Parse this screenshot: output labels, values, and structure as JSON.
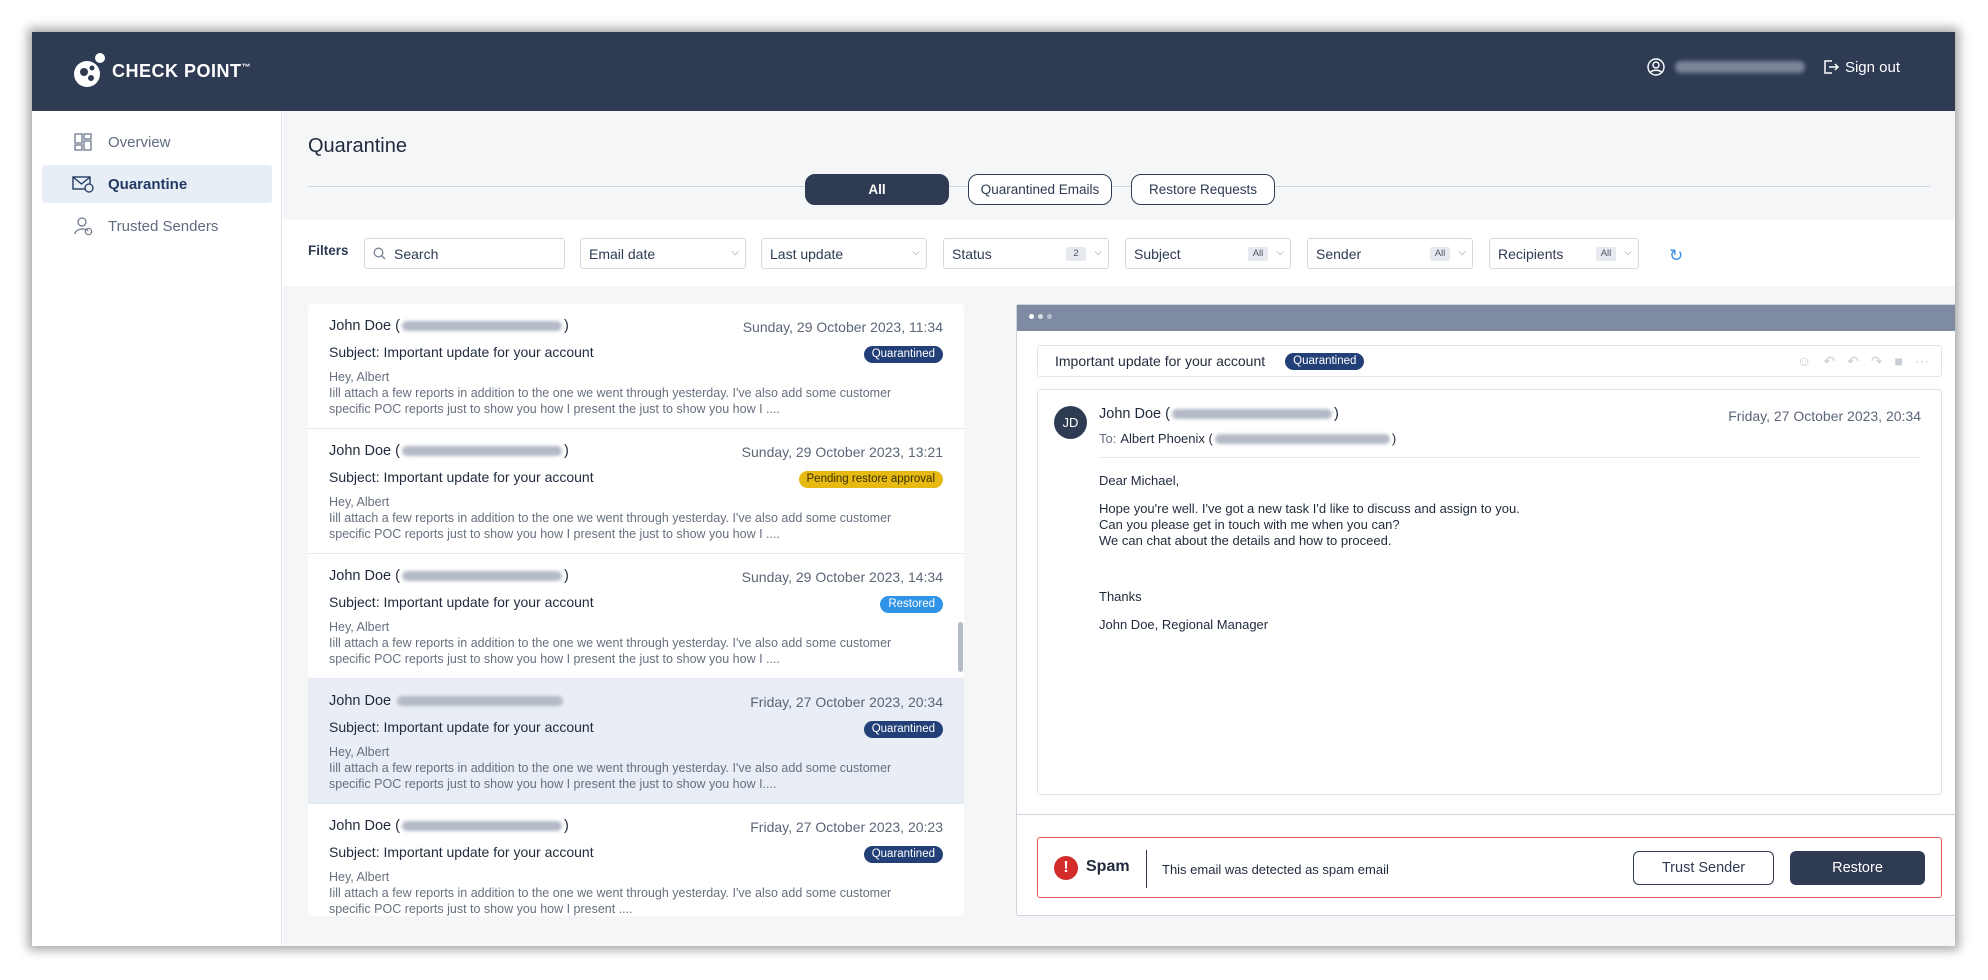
{
  "header": {
    "brand": "CHECK POINT",
    "brand_tm": "™",
    "sign_out": "Sign out"
  },
  "sidebar": {
    "items": [
      {
        "label": "Overview",
        "icon": "dashboard-icon"
      },
      {
        "label": "Quarantine",
        "icon": "mail-shield-icon",
        "active": true
      },
      {
        "label": "Trusted Senders",
        "icon": "user-check-icon"
      }
    ]
  },
  "page": {
    "title": "Quarantine",
    "tabs": [
      {
        "label": "All",
        "active": true
      },
      {
        "label": "Quarantined Emails"
      },
      {
        "label": "Restore Requests"
      }
    ]
  },
  "filters": {
    "label": "Filters",
    "search_placeholder": "Search",
    "email_date": "Email date",
    "last_update": "Last update",
    "status": "Status",
    "status_count": "2",
    "subject": "Subject",
    "subject_count": "All",
    "sender": "Sender",
    "sender_count": "All",
    "recipients": "Recipients",
    "recipients_count": "All"
  },
  "emails": [
    {
      "from": "John Doe (",
      "from_close": ")",
      "date": "Sunday, 29 October 2023, 11:34",
      "subject": "Subject: Important update for your account",
      "status": "Quarantined",
      "greeting": "Hey,  Albert",
      "body": "Iill attach a few reports in addition to the one we went through yesterday. I've also add some customer specific POC reports just to show you how I present the just to show you how I ...."
    },
    {
      "from": "John Doe (",
      "from_close": ")",
      "date": "Sunday, 29 October 2023, 13:21",
      "subject": "Subject: Important update for your account",
      "status": "Pending restore approval",
      "greeting": "Hey,  Albert",
      "body": "Iill attach a few reports in addition to the one we went through yesterday. I've also add some customer specific POC reports just to show you how I present the just to show you how I ...."
    },
    {
      "from": "John Doe (",
      "from_close": ")",
      "date": "Sunday, 29 October 2023, 14:34",
      "subject": "Subject: Important update for your account",
      "status": "Restored",
      "greeting": "Hey,  Albert",
      "body": "Iill attach a few reports in addition to the one we went through yesterday. I've also add some customer specific POC reports just to show you how I present the just to show you how I ...."
    },
    {
      "from": "John Doe",
      "from_close": "",
      "date": "Friday, 27 October 2023, 20:34",
      "subject": "Subject: Important update for your account",
      "status": "Quarantined",
      "greeting": "Hey,  Albert",
      "body": "Iill attach a few reports in addition to the one we went through yesterday. I've also add some customer specific POC reports just to show you how I present the just to show you how I...."
    },
    {
      "from": "John Doe (",
      "from_close": ")",
      "date": "Friday, 27 October 2023, 20:23",
      "subject": "Subject: Important update for your account",
      "status": "Quarantined",
      "greeting": "Hey,  Albert",
      "body": "Iill attach a few reports in addition to the one we went through yesterday. I've also add some customer specific POC reports just to show you how I present ...."
    }
  ],
  "viewer": {
    "subject": "Important update for your account",
    "status": "Quarantined",
    "avatar": "JD",
    "from": "John Doe (",
    "from_close": ")",
    "date": "Friday, 27 October 2023, 20:34",
    "to_label": "To:",
    "to_name": "Albert Phoenix (",
    "to_close": ")",
    "body": {
      "salutation": "Dear Michael,",
      "line1": "Hope you're well. I've got a new task I'd like to discuss and assign to you.",
      "line2": "Can you please get in touch with me when you can?",
      "line3": "We can chat about the details and how to proceed.",
      "thanks": "Thanks",
      "signature": "John Doe, Regional Manager"
    },
    "alert": {
      "icon_glyph": "!",
      "title": "Spam",
      "text": "This email was detected as spam email",
      "trust_button": "Trust Sender",
      "restore_button": "Restore"
    }
  }
}
